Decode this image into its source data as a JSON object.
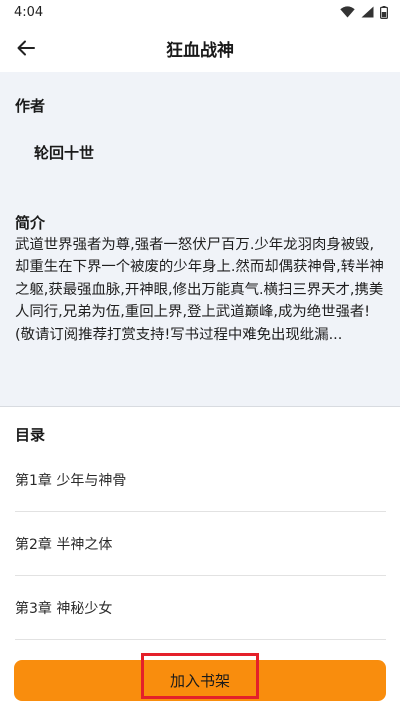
{
  "status": {
    "time": "4:04"
  },
  "header": {
    "title": "狂血战神"
  },
  "author": {
    "heading": "作者",
    "name": "轮回十世"
  },
  "intro": {
    "heading": "简介",
    "text": "武道世界强者为尊,强者一怒伏尸百万.少年龙羽肉身被毁,却重生在下界一个被废的少年身上.然而却偶获神骨,转半神之躯,获最强血脉,开神眼,修出万能真气.横扫三界天才,携美人同行,兄弟为伍,重回上界,登上武道巅峰,成为绝世强者!(敬请订阅推荐打赏支持!写书过程中难免出现纰漏..."
  },
  "toc": {
    "heading": "目录",
    "chapters": [
      "第1章 少年与神骨",
      "第2章 半神之体",
      "第3章 神秘少女"
    ]
  },
  "actions": {
    "add_to_shelf": "加入书架"
  },
  "colors": {
    "accent": "#f98d0d",
    "panel_bg": "#f0f3f8",
    "highlight": "#e4202a"
  },
  "icons": {
    "back": "arrow-left-icon",
    "wifi": "wifi-icon",
    "signal": "signal-icon",
    "battery": "battery-icon"
  }
}
